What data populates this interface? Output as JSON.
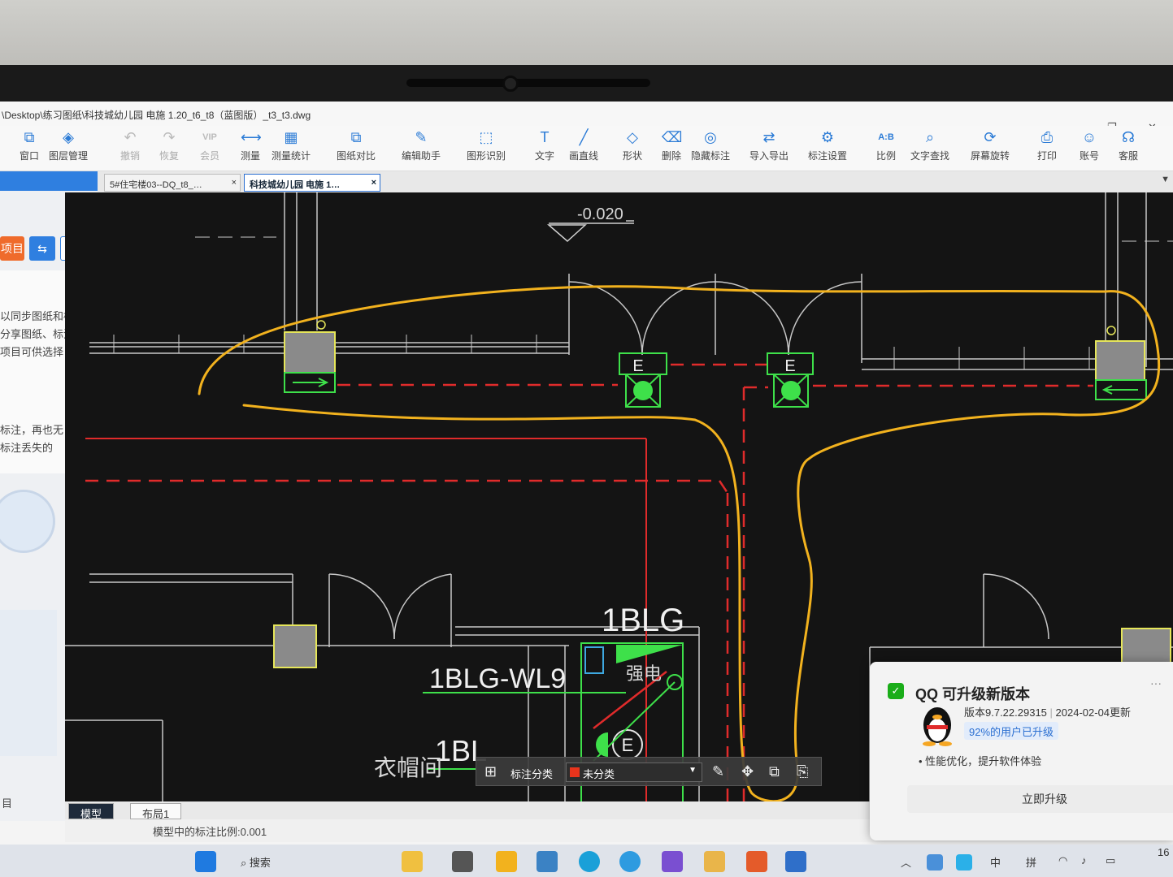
{
  "window": {
    "title": "\\Desktop\\练习图纸\\科技城幼儿园 电施 1.20_t6_t8（蓝图版）_t3_t3.dwg",
    "minimize": "—",
    "restore": "❐",
    "close": "✕"
  },
  "toolbar": {
    "items": [
      {
        "label": "窗口",
        "icon": "window-icon",
        "glyph": "⧉",
        "enabled": true
      },
      {
        "label": "图层管理",
        "icon": "layers-icon",
        "glyph": "◈",
        "enabled": true
      },
      {
        "label": "撤销",
        "icon": "undo-icon",
        "glyph": "↶",
        "enabled": false
      },
      {
        "label": "恢复",
        "icon": "redo-icon",
        "glyph": "↷",
        "enabled": false
      },
      {
        "label": "会员",
        "icon": "vip-icon",
        "glyph": "VIP",
        "enabled": false
      },
      {
        "label": "测量",
        "icon": "measure-icon",
        "glyph": "⟷",
        "enabled": true
      },
      {
        "label": "测量统计",
        "icon": "measure-stats-icon",
        "glyph": "▦",
        "enabled": true
      },
      {
        "label": "图纸对比",
        "icon": "compare-icon",
        "glyph": "⧉",
        "enabled": true
      },
      {
        "label": "编辑助手",
        "icon": "edit-assistant-icon",
        "glyph": "✎",
        "enabled": true
      },
      {
        "label": "图形识别",
        "icon": "shape-recognize-icon",
        "glyph": "⬚",
        "enabled": true
      },
      {
        "label": "文字",
        "icon": "text-icon",
        "glyph": "T",
        "enabled": true
      },
      {
        "label": "画直线",
        "icon": "line-icon",
        "glyph": "╱",
        "enabled": true
      },
      {
        "label": "形状",
        "icon": "shape-icon",
        "glyph": "◇",
        "enabled": true
      },
      {
        "label": "删除",
        "icon": "eraser-icon",
        "glyph": "⌫",
        "enabled": true
      },
      {
        "label": "隐藏标注",
        "icon": "hide-annotation-icon",
        "glyph": "◎",
        "enabled": true
      },
      {
        "label": "导入导出",
        "icon": "import-export-icon",
        "glyph": "⇄",
        "enabled": true
      },
      {
        "label": "标注设置",
        "icon": "annotation-settings-icon",
        "glyph": "⚙",
        "enabled": true
      },
      {
        "label": "比例",
        "icon": "scale-icon",
        "glyph": "A:B",
        "enabled": true
      },
      {
        "label": "文字查找",
        "icon": "text-search-icon",
        "glyph": "⌕",
        "enabled": true
      },
      {
        "label": "屏幕旋转",
        "icon": "screen-rotate-icon",
        "glyph": "⟳",
        "enabled": true
      },
      {
        "label": "打印",
        "icon": "print-icon",
        "glyph": "⎙",
        "enabled": true
      },
      {
        "label": "账号",
        "icon": "account-icon",
        "glyph": "☺",
        "enabled": true
      },
      {
        "label": "客服",
        "icon": "headset-icon",
        "glyph": "☊",
        "enabled": true
      }
    ]
  },
  "tabs": [
    {
      "label": "5#住宅楼03--DQ_t8_…",
      "close": "×",
      "active": false
    },
    {
      "label": "科技城幼儿园 电施 1…",
      "close": "×",
      "active": true
    }
  ],
  "sidebar": {
    "project_label": "项目",
    "lines1": [
      "以同步图纸和标",
      "分享图纸、标注",
      "项目可供选择！"
    ],
    "lines2": [
      "标注，再也无",
      "标注丢失的"
    ],
    "footer": "目"
  },
  "drawing": {
    "elevation": "-0.020",
    "label_1blg": "1BLG",
    "label_wl9": "1BLG-WL9",
    "label_1bl": "1BL",
    "label_room": "衣帽间",
    "label_strong": "强电",
    "label_e": "E",
    "label_1blg_partial": "1BLG"
  },
  "annotation_bar": {
    "category_label": "标注分类",
    "selected": "未分类",
    "selected_color": "#e8341c"
  },
  "bottom_tabs": [
    {
      "label": "模型",
      "active": true
    },
    {
      "label": "布局1",
      "active": false
    }
  ],
  "status": {
    "scale_text": "模型中的标注比例:0.001"
  },
  "qq_popup": {
    "title": "QQ 可升级新版本",
    "more": "···",
    "version": "版本9.7.22.29315",
    "date": "2024-02-04更新",
    "percent": "92%的用户已升级",
    "feature": "性能优化，提升软件体验",
    "upgrade_button": "立即升级"
  },
  "taskbar": {
    "search_placeholder": "搜索",
    "ime_1": "中",
    "ime_2": "拼",
    "time": "16"
  }
}
